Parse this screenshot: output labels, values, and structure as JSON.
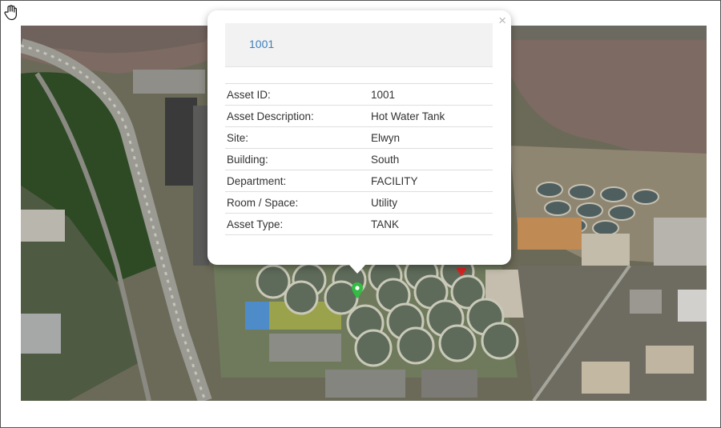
{
  "popup": {
    "title": "1001",
    "close_symbol": "×",
    "rows": [
      {
        "label": "Asset ID:",
        "value": "1001"
      },
      {
        "label": "Asset Description:",
        "value": "Hot Water Tank"
      },
      {
        "label": "Site:",
        "value": "Elwyn"
      },
      {
        "label": "Building:",
        "value": "South"
      },
      {
        "label": "Department:",
        "value": "FACILITY"
      },
      {
        "label": "Room / Space:",
        "value": "Utility"
      },
      {
        "label": "Asset Type:",
        "value": "TANK"
      }
    ]
  },
  "map": {
    "description_icon": "aerial-satellite-map",
    "markers": [
      {
        "name": "green-marker",
        "color": "#33bb44"
      },
      {
        "name": "red-marker",
        "color": "#dd2222"
      }
    ]
  },
  "cursor": {
    "icon": "hand-pointer-icon"
  }
}
